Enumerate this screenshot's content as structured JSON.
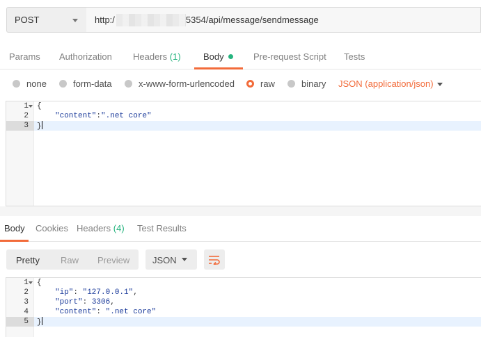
{
  "request": {
    "method": "POST",
    "url_prefix": "http:/",
    "url_suffix": "5354/api/message/sendmessage"
  },
  "request_tabs": {
    "params": "Params",
    "authorization": "Authorization",
    "headers": "Headers",
    "headers_count": "(1)",
    "body": "Body",
    "prerequest": "Pre-request Script",
    "tests": "Tests"
  },
  "body_types": {
    "none": "none",
    "form_data": "form-data",
    "urlencoded": "x-www-form-urlencoded",
    "raw": "raw",
    "binary": "binary",
    "selected": "raw",
    "content_type": "JSON (application/json)"
  },
  "request_body": {
    "line_numbers": [
      "1",
      "2",
      "3"
    ],
    "line1": "{",
    "line2_key": "\"content\"",
    "line2_sep": ":",
    "line2_value": "\".net core\"",
    "line3": "}"
  },
  "response_tabs": {
    "body": "Body",
    "cookies": "Cookies",
    "headers": "Headers",
    "headers_count": "(4)",
    "test_results": "Test Results"
  },
  "response_toolbar": {
    "pretty": "Pretty",
    "raw": "Raw",
    "preview": "Preview",
    "format": "JSON"
  },
  "response_body": {
    "line_numbers": [
      "1",
      "2",
      "3",
      "4",
      "5"
    ],
    "line1": "{",
    "ip_key": "\"ip\"",
    "ip_value": "\"127.0.0.1\"",
    "port_key": "\"port\"",
    "port_value": "3306",
    "content_key": "\"content\"",
    "content_value": "\".net core\"",
    "line5": "}"
  },
  "colors": {
    "accent": "#f26b3a",
    "count_green": "#26b47f",
    "code_blue": "#1a3a9a"
  },
  "icons": {
    "wrap": "wrap-lines-icon",
    "fold": "fold-caret-icon"
  }
}
